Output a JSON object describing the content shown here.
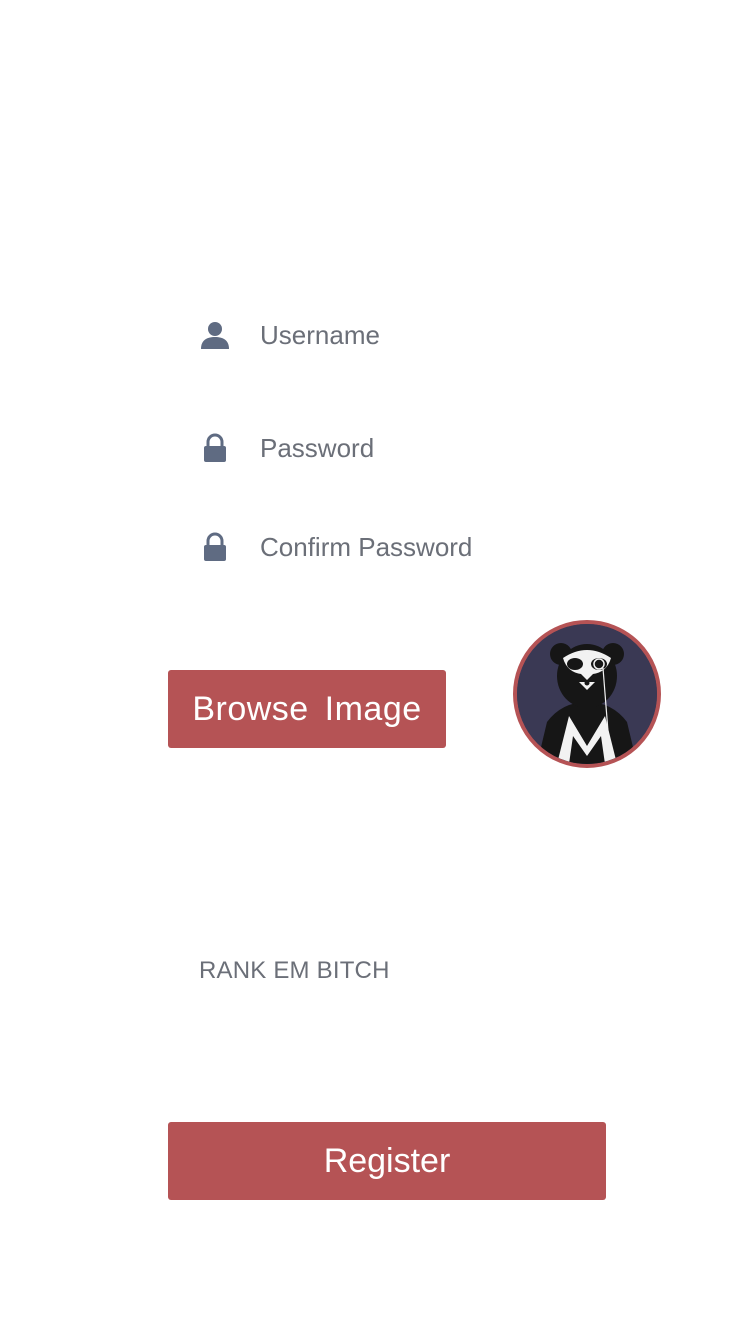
{
  "form": {
    "username": {
      "value": "",
      "placeholder": "Username",
      "icon": "user-icon"
    },
    "password": {
      "value": "",
      "placeholder": "Password",
      "icon": "lock-icon"
    },
    "confirm_password": {
      "value": "",
      "placeholder": "Confirm Password",
      "icon": "lock-icon"
    }
  },
  "browse_button": {
    "label": "Browse  Image"
  },
  "avatar": {
    "icon": "panda-avatar-icon"
  },
  "rank_label": "RANK EM BITCH",
  "register_button": {
    "label": "Register"
  },
  "colors": {
    "accent": "#b55355",
    "text": "#6b6f78",
    "icon": "#5f6b82",
    "avatar_bg": "#3a3954",
    "background": "#ffffff"
  }
}
